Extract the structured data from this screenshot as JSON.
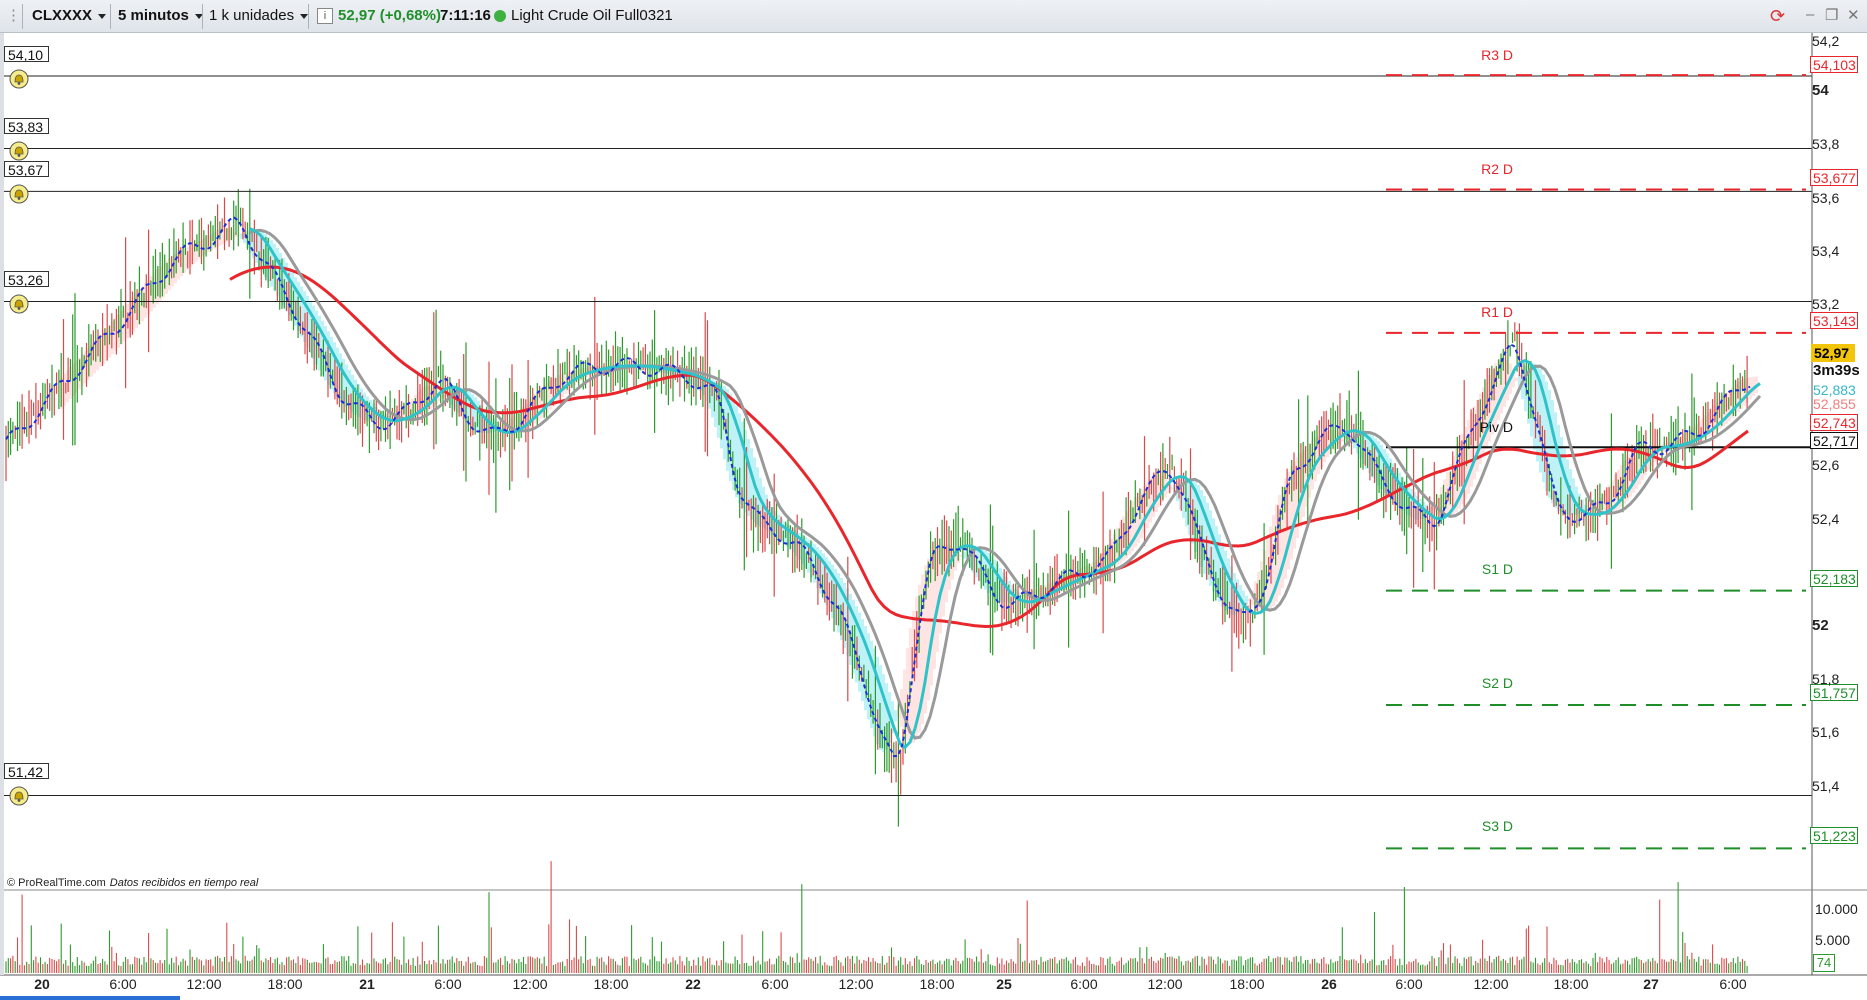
{
  "toolbar": {
    "symbol": "CLXXXX",
    "timeframe": "5 minutos",
    "units": "1 k unidades",
    "price_change": "52,97 (+0,68%)",
    "time": "7:11:16",
    "instrument": "Light Crude Oil Full0321"
  },
  "chart": {
    "credits": "© ProRealTime.com",
    "credits_note": "Datos recibidos en tiempo real",
    "alert_levels": [
      "54,10",
      "53,83",
      "53,67",
      "53,26",
      "51,42"
    ],
    "pivots": [
      {
        "name": "R3 D",
        "value": "54,103",
        "color": "#e8262b"
      },
      {
        "name": "R2 D",
        "value": "53,677",
        "color": "#e8262b"
      },
      {
        "name": "R1 D",
        "value": "53,143",
        "color": "#e8262b"
      },
      {
        "name": "Piv D",
        "value": "52,717",
        "color": "#111111"
      },
      {
        "name": "S1 D",
        "value": "52,183",
        "color": "#1f8f2a"
      },
      {
        "name": "S2 D",
        "value": "51,757",
        "color": "#1f8f2a"
      },
      {
        "name": "S3 D",
        "value": "51,223",
        "color": "#1f8f2a"
      }
    ],
    "price_axis_ticks": [
      "54,2",
      "54",
      "53,8",
      "53,6",
      "53,4",
      "53,2",
      "52,6",
      "52,4",
      "52",
      "51,8",
      "51,6",
      "51,4"
    ],
    "last_price": "52,97",
    "countdown": "3m39s",
    "indicator_values": [
      {
        "value": "52,883",
        "color": "#34b7c8"
      },
      {
        "value": "52,855",
        "color": "#f07f7f"
      },
      {
        "value": "52,743",
        "color": "#e8262b"
      }
    ],
    "volume_axis_ticks": [
      "10.000",
      "5.000"
    ],
    "volume_last": "74",
    "time_axis": [
      "20",
      "6:00",
      "12:00",
      "18:00",
      "21",
      "6:00",
      "12:00",
      "18:00",
      "22",
      "6:00",
      "12:00",
      "18:00",
      "25",
      "6:00",
      "12:00",
      "18:00",
      "26",
      "6:00",
      "12:00",
      "18:00",
      "27",
      "6:00"
    ],
    "colors": {
      "up": "#2e9a2e",
      "down": "#d94a4a",
      "ma_long": "#e8262b",
      "ma_fast": "#2ec3c9",
      "ma_slow": "#9a9a9a",
      "dashed": "#1a2fd6",
      "cloud": "#bff2f7"
    }
  }
}
